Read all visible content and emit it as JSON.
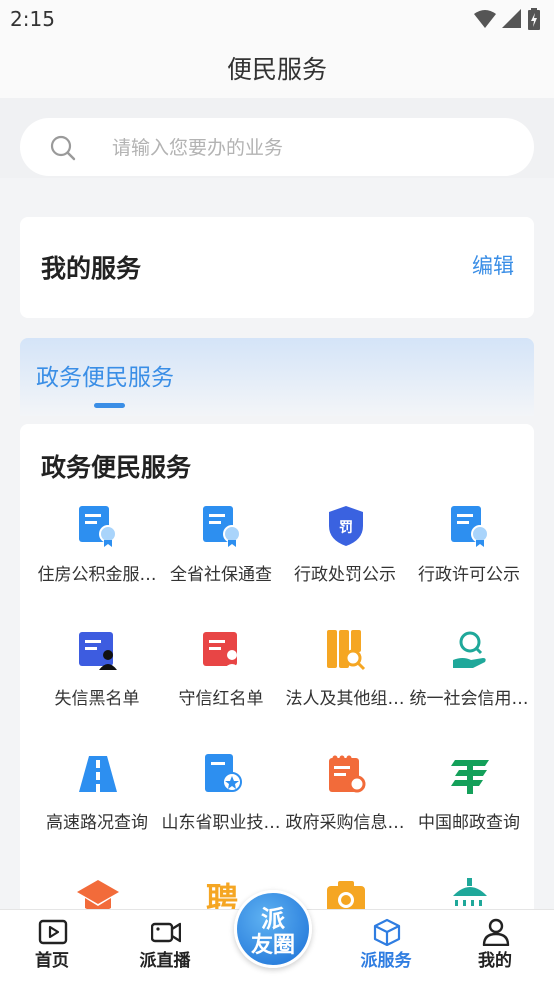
{
  "status": {
    "time": "2:15"
  },
  "header": {
    "title": "便民服务"
  },
  "search": {
    "placeholder": "请输入您要办的业务"
  },
  "my_service": {
    "title": "我的服务",
    "edit_label": "编辑"
  },
  "tabs": [
    {
      "label": "政务便民服务",
      "active": true
    }
  ],
  "section": {
    "title": "政务便民服务",
    "items": [
      {
        "label": "住房公积金服…",
        "icon": "certificate-blue-icon"
      },
      {
        "label": "全省社保通查",
        "icon": "certificate-blue-icon"
      },
      {
        "label": "行政处罚公示",
        "icon": "penalty-shield-icon"
      },
      {
        "label": "行政许可公示",
        "icon": "certificate-blue-icon"
      },
      {
        "label": "失信黑名单",
        "icon": "blacklist-icon"
      },
      {
        "label": "守信红名单",
        "icon": "redlist-icon"
      },
      {
        "label": "法人及其他组…",
        "icon": "document-search-icon"
      },
      {
        "label": "统一社会信用…",
        "icon": "credit-search-hand-icon"
      },
      {
        "label": "高速路况查询",
        "icon": "highway-icon"
      },
      {
        "label": "山东省职业技…",
        "icon": "certificate-star-icon"
      },
      {
        "label": "政府采购信息…",
        "icon": "procurement-icon"
      },
      {
        "label": "中国邮政查询",
        "icon": "china-post-icon"
      },
      {
        "label": "",
        "icon": "graduation-cap-icon"
      },
      {
        "label": "",
        "icon": "recruit-icon"
      },
      {
        "label": "",
        "icon": "camera-icon"
      },
      {
        "label": "",
        "icon": "shower-icon"
      }
    ]
  },
  "bottom_nav": [
    {
      "label": "首页",
      "icon": "play-box-icon"
    },
    {
      "label": "派直播",
      "icon": "video-camera-icon"
    },
    {
      "label": "派服务",
      "icon": "cube-icon",
      "active": true
    },
    {
      "label": "我的",
      "icon": "user-icon"
    }
  ],
  "center_button": {
    "line1": "派",
    "line2": "友圈"
  },
  "colors": {
    "accent": "#3a8ee6",
    "nav_active": "#2f7de1"
  }
}
